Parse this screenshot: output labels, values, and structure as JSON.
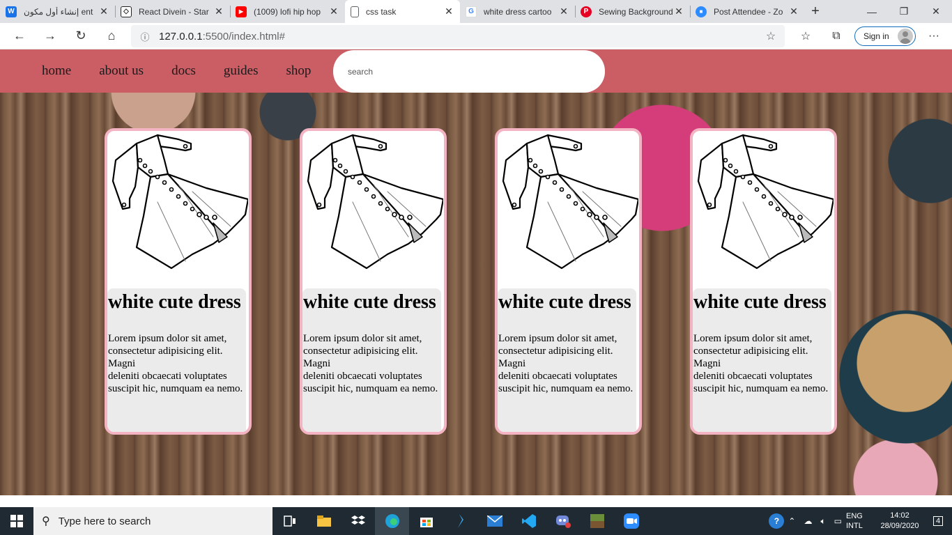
{
  "browser": {
    "tabs": [
      {
        "title": "إنشاء أول مكون ent",
        "favicon": "bookmark-icon",
        "color": "#1a73e8"
      },
      {
        "title": "React Divein - Star",
        "favicon": "codepen-icon",
        "color": "#222222"
      },
      {
        "title": "(1009) lofi hip hop",
        "favicon": "youtube-icon",
        "color": "#ff0000"
      },
      {
        "title": "css task",
        "favicon": "page-icon",
        "color": "#5f6368"
      },
      {
        "title": "white dress cartoo",
        "favicon": "google-icon",
        "color": "#4285f4"
      },
      {
        "title": "Sewing Background",
        "favicon": "pinterest-icon",
        "color": "#e60023"
      },
      {
        "title": "Post Attendee - Zo",
        "favicon": "zoom-icon",
        "color": "#2d8cff"
      }
    ],
    "url_host": "127.0.0.1",
    "url_path": ":5500/index.html#",
    "signin_label": "Sign in"
  },
  "nav": {
    "links": [
      "home",
      "about us",
      "docs",
      "guides",
      "shop"
    ],
    "search_placeholder": "search"
  },
  "cards": [
    {
      "title": "white cute dress",
      "text": "Lorem ipsum dolor sit amet, consectetur adipisicing elit. Magni\ndeleniti obcaecati voluptates suscipit hic, numquam ea nemo."
    },
    {
      "title": "white cute dress",
      "text": "Lorem ipsum dolor sit amet, consectetur adipisicing elit. Magni\ndeleniti obcaecati voluptates suscipit hic, numquam ea nemo."
    },
    {
      "title": "white cute dress",
      "text": "Lorem ipsum dolor sit amet, consectetur adipisicing elit. Magni\ndeleniti obcaecati voluptates suscipit hic, numquam ea nemo."
    },
    {
      "title": "white cute dress",
      "text": "Lorem ipsum dolor sit amet, consectetur adipisicing elit. Magni\ndeleniti obcaecati voluptates suscipit hic, numquam ea nemo."
    }
  ],
  "taskbar": {
    "search_placeholder": "Type here to search",
    "lang_line1": "ENG",
    "lang_line2": "INTL",
    "time": "14:02",
    "date": "28/09/2020",
    "notifications": "4"
  },
  "colors": {
    "navbar": "#cb5d64",
    "card_border": "#f4b3c3",
    "card_body": "#ebebeb"
  }
}
